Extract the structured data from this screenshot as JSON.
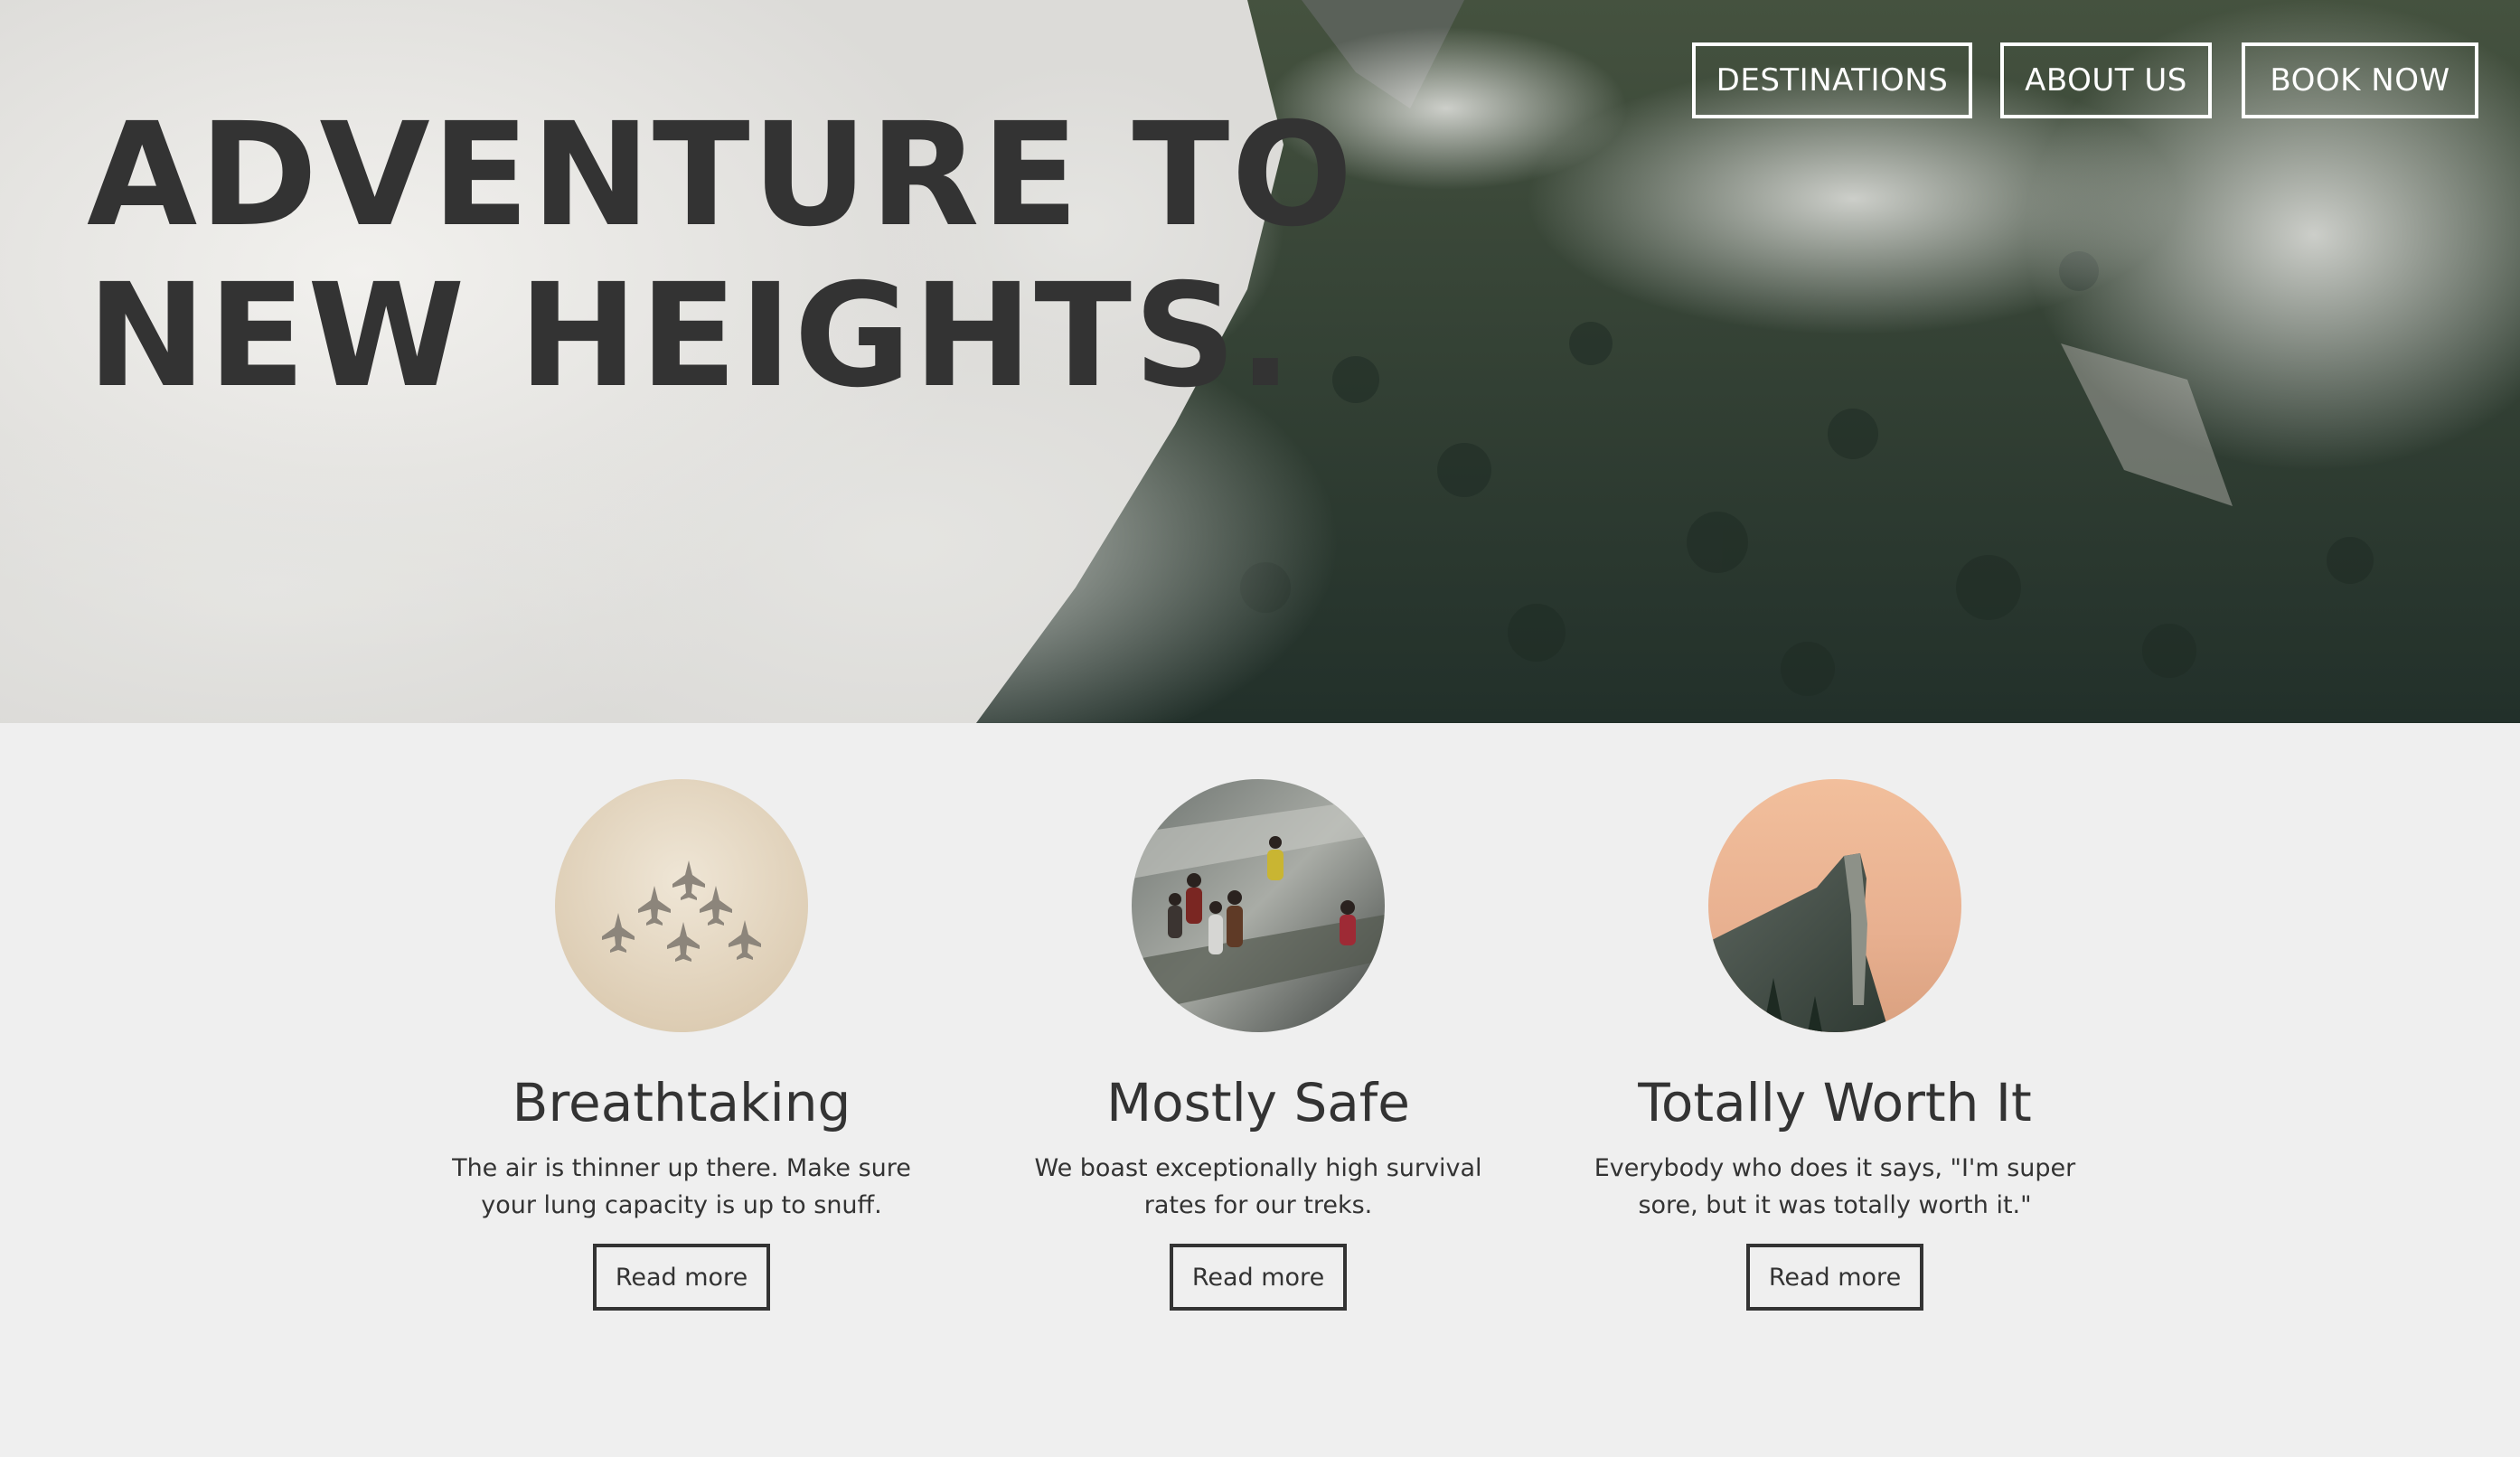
{
  "hero": {
    "title_line1": "ADVENTURE TO",
    "title_line2": "NEW HEIGHTS.",
    "background": "misty-forested-mountain-photo"
  },
  "nav": {
    "items": [
      {
        "label": "DESTINATIONS"
      },
      {
        "label": "ABOUT US"
      },
      {
        "label": "BOOK NOW"
      }
    ]
  },
  "features": [
    {
      "title": "Breathtaking",
      "text": "The air is thinner up there. Make sure your lung capacity is up to snuff.",
      "button": "Read more",
      "image": "jets-formation-image"
    },
    {
      "title": "Mostly Safe",
      "text": "We boast exceptionally high survival rates for our treks.",
      "button": "Read more",
      "image": "hikers-on-rock-image"
    },
    {
      "title": "Totally Worth It",
      "text": "Everybody who does it says, \"I'm super sore, but it was totally worth it.\"",
      "button": "Read more",
      "image": "cliff-sunset-image"
    }
  ],
  "colors": {
    "text": "#333333",
    "section_bg": "#efefef",
    "nav_border": "#ffffff"
  }
}
